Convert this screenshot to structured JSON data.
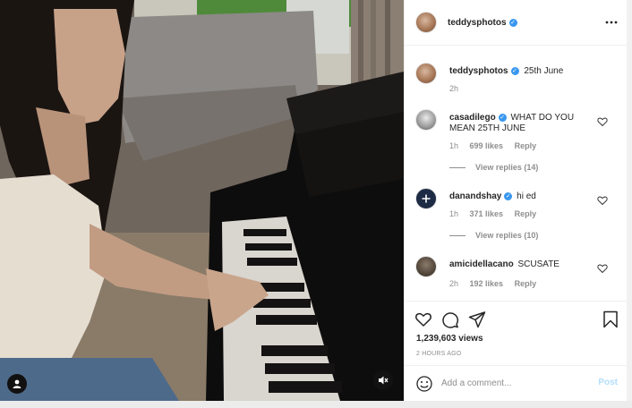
{
  "post": {
    "owner": "teddysphotos",
    "caption_date": "25th June",
    "caption_age": "2h",
    "views": "1,239,603 views",
    "posted_ago": "2 HOURS AGO"
  },
  "comments": [
    {
      "username": "casadilego",
      "verified": true,
      "text": "WHAT DO YOU MEAN 25TH JUNE",
      "age": "1h",
      "likes": "699 likes",
      "reply": "Reply",
      "replies": "View replies (14)"
    },
    {
      "username": "danandshay",
      "verified": true,
      "text": "hi ed",
      "age": "1h",
      "likes": "371 likes",
      "reply": "Reply",
      "replies": "View replies (10)"
    },
    {
      "username": "amicidellacano",
      "verified": false,
      "text": "SCUSATE",
      "age": "2h",
      "likes": "192 likes",
      "reply": "Reply"
    }
  ],
  "add_comment": {
    "placeholder": "Add a comment...",
    "post_label": "Post"
  },
  "icons": {
    "more": "more-horizontal-icon",
    "like": "heart-icon",
    "comment": "comment-icon",
    "share": "send-icon",
    "save": "bookmark-icon",
    "emoji": "emoji-icon",
    "mute": "speaker-muted-icon",
    "user_tag": "user-tag-icon"
  },
  "colors": {
    "verified": "#3897f0",
    "post_disabled": "#b2dffc",
    "muted_text": "#8e8e8e"
  }
}
